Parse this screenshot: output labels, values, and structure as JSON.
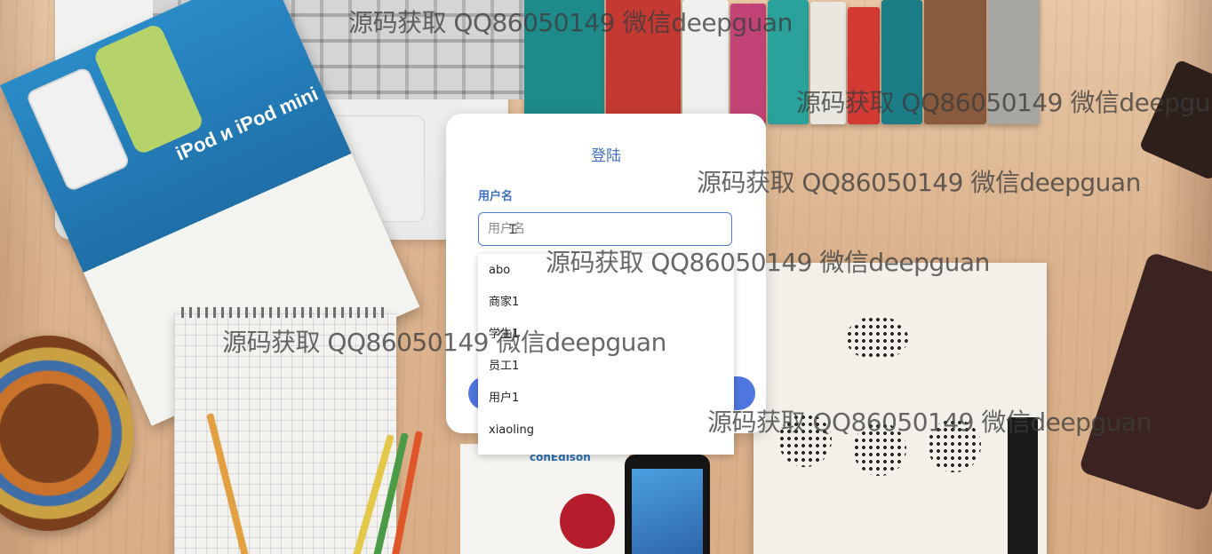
{
  "login": {
    "title": "登陆",
    "username_label": "用户名",
    "username_placeholder": "用户名"
  },
  "autocomplete": {
    "options": [
      "abo",
      "商家1",
      "学生1",
      "员工1",
      "用户1",
      "xiaoling"
    ]
  },
  "background": {
    "magazine_title": "iPod и iPod mini",
    "package_brand": "conEdison"
  },
  "watermark": {
    "text": "源码获取 QQ86050149 微信deepguan"
  },
  "colors": {
    "accent": "#3f6ec3",
    "button": "#4e76de",
    "input_border": "#4c7ad1"
  }
}
